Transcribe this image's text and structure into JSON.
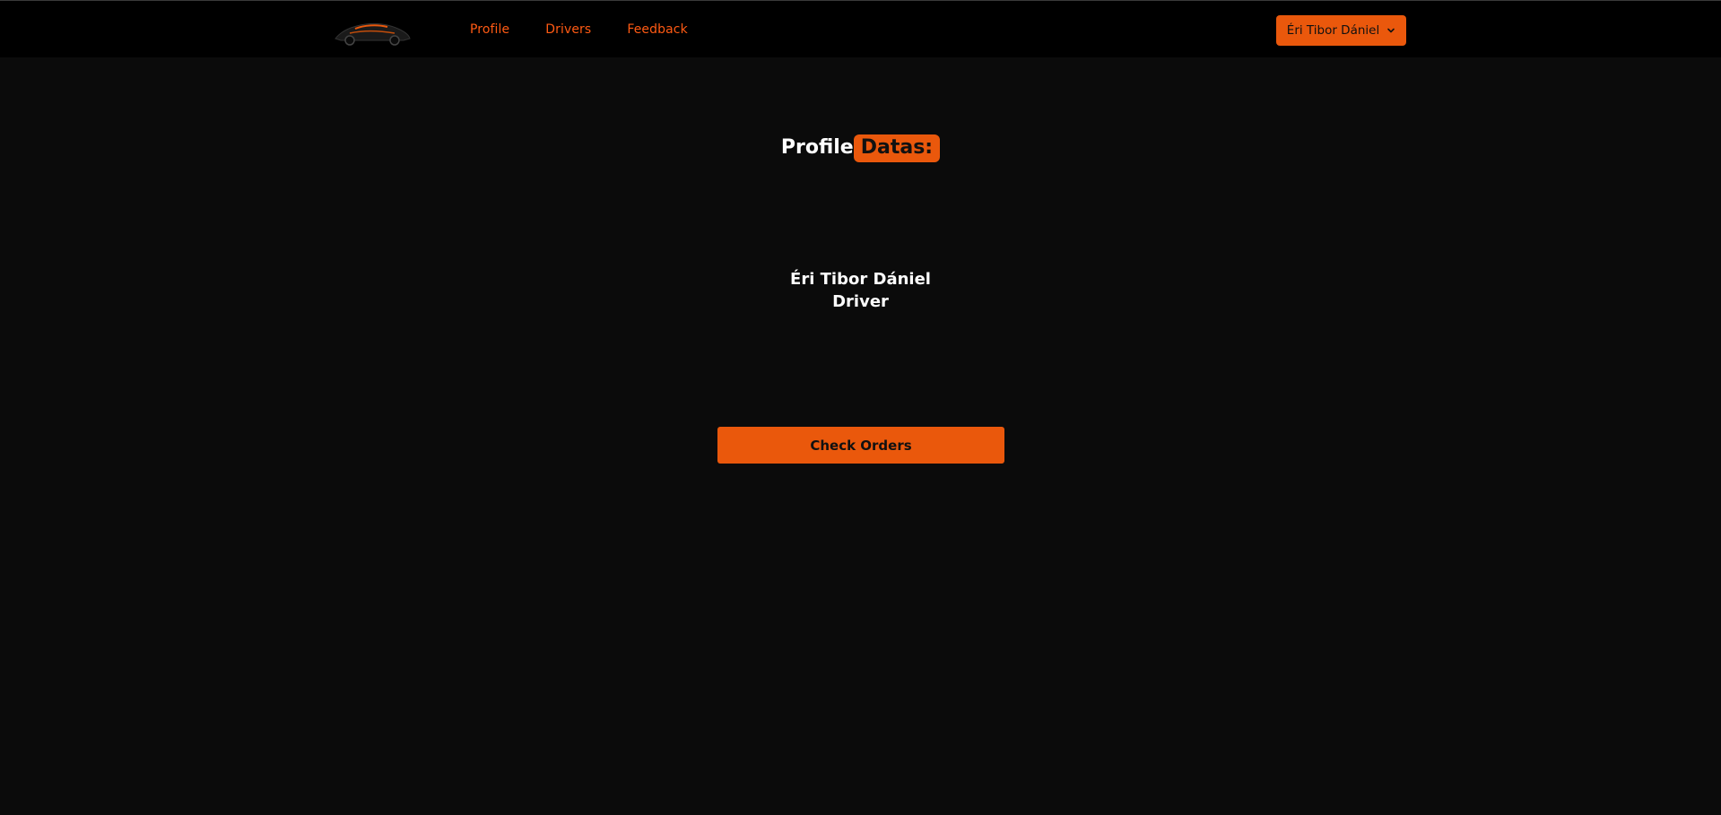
{
  "navbar": {
    "logo_icon": "sports-car-logo-icon",
    "links": [
      {
        "label": "Profile"
      },
      {
        "label": "Drivers"
      },
      {
        "label": "Feedback"
      }
    ],
    "user_menu": {
      "label": "Éri Tibor Dániel",
      "icon": "chevron-down-icon"
    }
  },
  "main": {
    "heading": {
      "text": "Profile",
      "accent": "Datas:"
    },
    "profile": {
      "name": "Éri Tibor Dániel",
      "role": "Driver"
    },
    "check_orders_label": "Check Orders"
  },
  "colors": {
    "accent": "#ea580c",
    "link": "#ff5a13",
    "navbar_bg": "#000000",
    "page_bg": "#0b0b0b"
  }
}
